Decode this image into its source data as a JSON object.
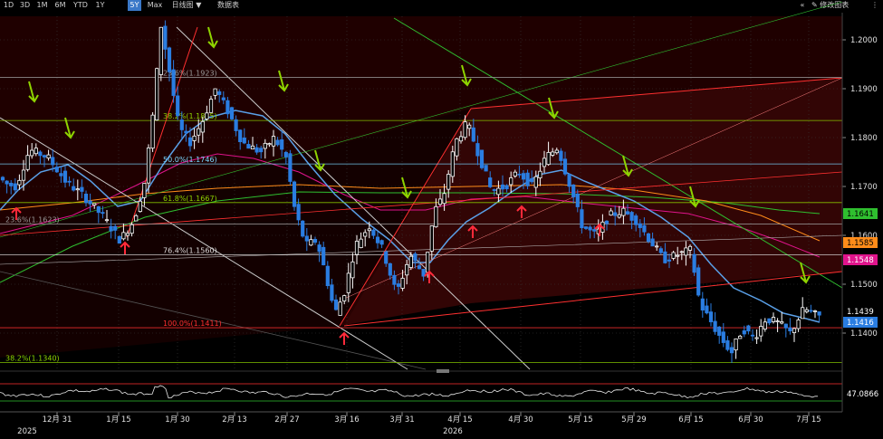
{
  "toolbar": {
    "tabs": [
      {
        "label": "1D",
        "active": false
      },
      {
        "label": "3D",
        "active": false
      },
      {
        "label": "1M",
        "active": false
      },
      {
        "label": "6M",
        "active": false
      },
      {
        "label": "YTD",
        "active": false
      },
      {
        "label": "1Y",
        "active": false
      },
      {
        "label": "5Y",
        "active": true
      },
      {
        "label": "Max",
        "active": false
      }
    ],
    "chart_type": "日线图",
    "chart_type_arrow": "▼",
    "data_table": "数据表",
    "collapse": "«",
    "edit_chart": "修改图表",
    "more": "⋮"
  },
  "colors": {
    "background": "#000000",
    "bull": "#ffffff",
    "bear": "#2a7de1",
    "grid": "#3a3a3a",
    "active_tab": "#3a78c8",
    "sig_down": "#8fd400",
    "sig_up": "#ff2a3a"
  },
  "chart_data": {
    "type": "candlestick",
    "y_axis": {
      "ticks": [
        "1.2000",
        "1.1900",
        "1.1800",
        "1.1700",
        "1.1600",
        "1.1500",
        "1.1400"
      ],
      "range": [
        1.1325,
        1.2065
      ]
    },
    "x_axis": {
      "ticks": [
        "12月 31",
        "1月 15",
        "1月 30",
        "2月 13",
        "2月 27",
        "3月 16",
        "3月 31",
        "4月 15",
        "4月 30",
        "5月 15",
        "5月 29",
        "6月 15",
        "6月 30",
        "7月 15"
      ],
      "years": [
        {
          "label": "2025",
          "at": 0
        },
        {
          "label": "2026",
          "at": 7
        }
      ]
    },
    "price_badges": [
      {
        "value": "1.1641",
        "color": "#2fbf2f",
        "text_color": "#000000"
      },
      {
        "value": "1.1585",
        "color": "#ff8c1a",
        "text_color": "#000000"
      },
      {
        "value": "1.1548",
        "color": "#e0148c",
        "text_color": "#ffffff"
      },
      {
        "value": "1.1439",
        "color": "#000000",
        "text_color": "#ffffff"
      },
      {
        "value": "1.1416",
        "color": "#2a7de1",
        "text_color": "#ffffff"
      }
    ],
    "fib_levels": [
      {
        "label": "23.6%(1.1923)",
        "value": 1.1923,
        "color": "#9a9a9a"
      },
      {
        "label": "38.2%(1.1835)",
        "value": 1.1835,
        "color": "#8fd400"
      },
      {
        "label": "50.0%(1.1746)",
        "value": 1.1746,
        "color": "#7ad7ff"
      },
      {
        "label": "61.8%(1.1667)",
        "value": 1.1667,
        "color": "#8fd400"
      },
      {
        "label": "76.4%(1.1560)",
        "value": 1.156,
        "color": "#dddddd"
      },
      {
        "label": "100.0%(1.1411)",
        "value": 1.1411,
        "color": "#ff3030"
      },
      {
        "label": "23.6%(1.1623)",
        "value": 1.1623,
        "color": "#9a9a9a"
      },
      {
        "label": "38.2%(1.1340)",
        "value": 1.134,
        "color": "#8fd400"
      }
    ],
    "oscillator": {
      "value": "47.0866",
      "range": [
        20,
        80
      ]
    }
  }
}
